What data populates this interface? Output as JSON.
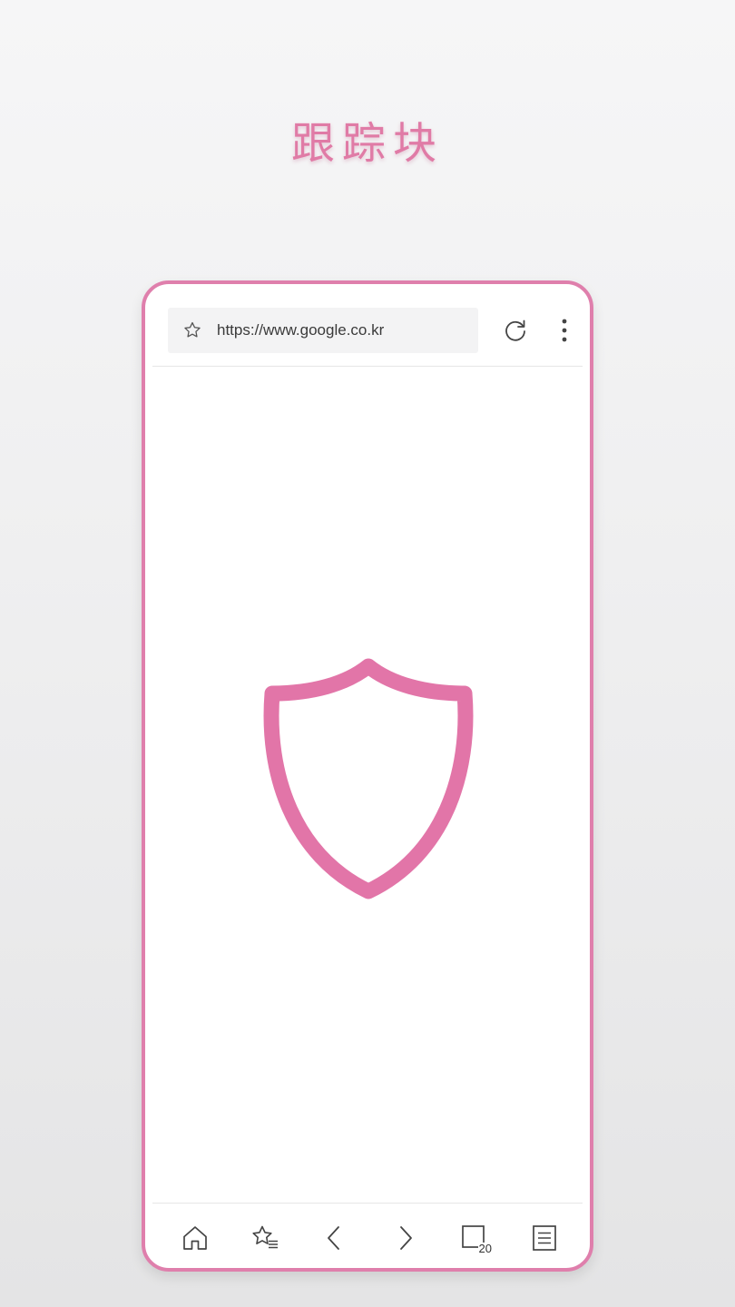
{
  "header": {
    "title": "跟踪块"
  },
  "browser": {
    "url": "https://www.google.co.kr",
    "bookmark_icon": "star-outline",
    "reload_icon": "reload",
    "menu_icon": "vertical-dots"
  },
  "content": {
    "icon": "shield-outline",
    "accent_color": "#e275a8"
  },
  "bottom_nav": {
    "items": [
      {
        "icon": "home"
      },
      {
        "icon": "bookmarks-star-list"
      },
      {
        "icon": "back-chevron"
      },
      {
        "icon": "forward-chevron"
      },
      {
        "icon": "tabs",
        "count": "20"
      },
      {
        "icon": "menu-list"
      }
    ]
  },
  "colors": {
    "frame": "#df7fac",
    "title": "#e07ba6"
  }
}
